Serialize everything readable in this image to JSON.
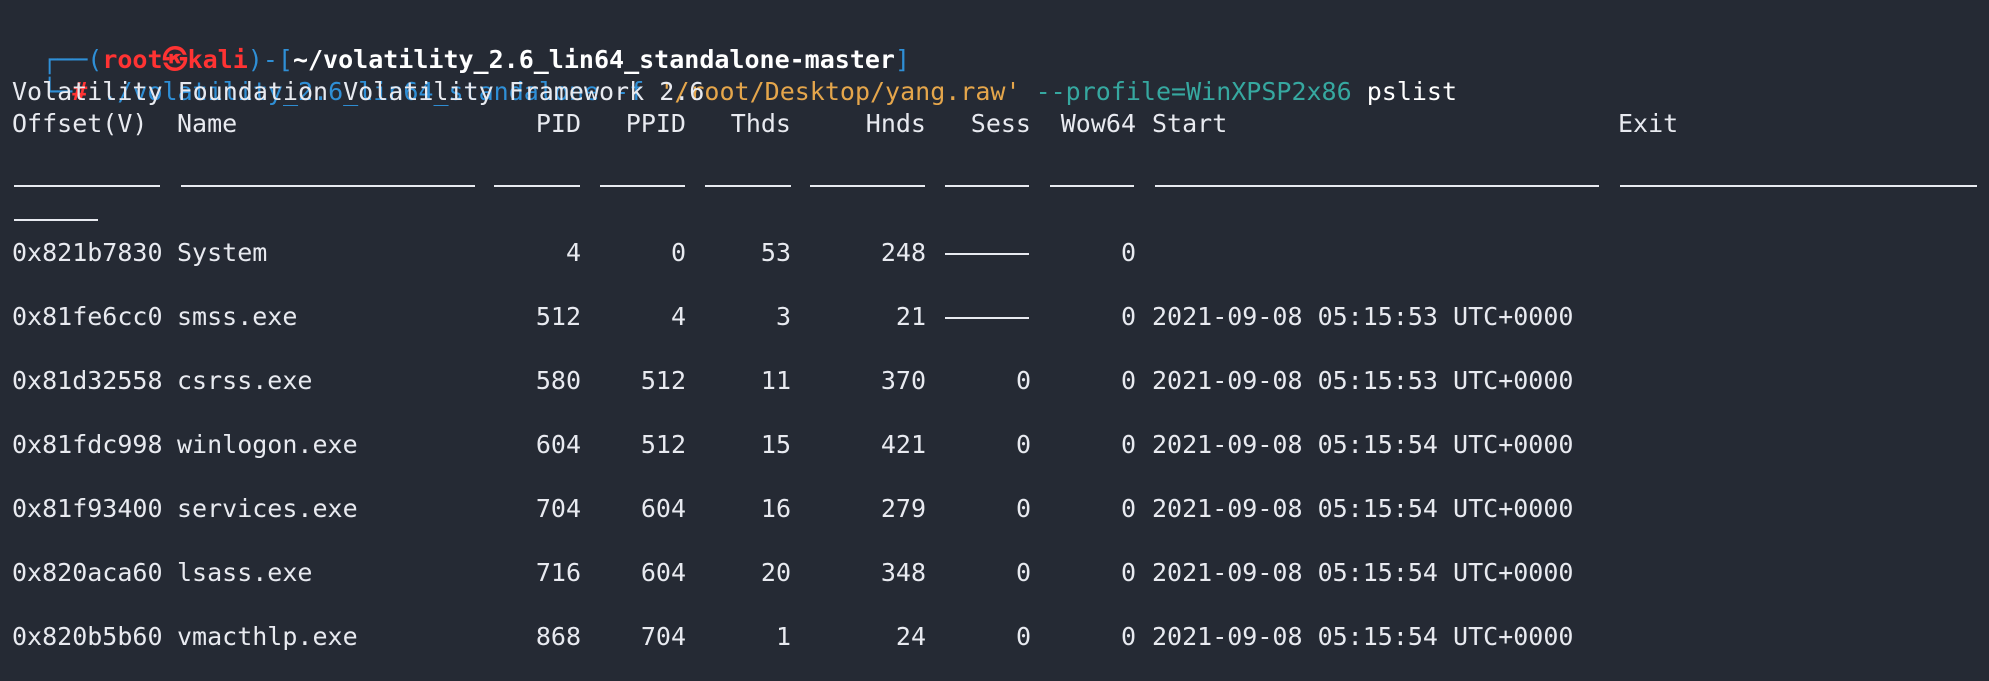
{
  "prompt": {
    "corner_top": "┌──(",
    "user": "root",
    "at_symbol": "㉿",
    "host": "kali",
    "bracket_mid": ")-[",
    "path": "~/volatility_2.6_lin64_standalone-master",
    "bracket_end": "]",
    "corner_bottom": "└─",
    "hash": "#"
  },
  "command": {
    "executable": "./volatility_2.6_lin64_standalone",
    "flag_f": "-f",
    "file_arg": "'/root/Desktop/yang.raw'",
    "profile": "--profile=WinXPSP2x86",
    "plugin": "pslist"
  },
  "banner": "Volatility Foundation Volatility Framework 2.6",
  "headers": [
    "Offset(V)",
    "Name",
    "PID",
    "PPID",
    "Thds",
    "Hnds",
    "Sess",
    "Wow64",
    "Start",
    "Exit"
  ],
  "rows": [
    {
      "offset": "0x821b7830",
      "name": "System",
      "pid": "4",
      "ppid": "0",
      "thds": "53",
      "hnds": "248",
      "sess": "------",
      "wow64": "0",
      "start": "",
      "exit": ""
    },
    {
      "offset": "0x81fe6cc0",
      "name": "smss.exe",
      "pid": "512",
      "ppid": "4",
      "thds": "3",
      "hnds": "21",
      "sess": "------",
      "wow64": "0",
      "start": "2021-09-08 05:15:53 UTC+0000",
      "exit": ""
    },
    {
      "offset": "0x81d32558",
      "name": "csrss.exe",
      "pid": "580",
      "ppid": "512",
      "thds": "11",
      "hnds": "370",
      "sess": "0",
      "wow64": "0",
      "start": "2021-09-08 05:15:53 UTC+0000",
      "exit": ""
    },
    {
      "offset": "0x81fdc998",
      "name": "winlogon.exe",
      "pid": "604",
      "ppid": "512",
      "thds": "15",
      "hnds": "421",
      "sess": "0",
      "wow64": "0",
      "start": "2021-09-08 05:15:54 UTC+0000",
      "exit": ""
    },
    {
      "offset": "0x81f93400",
      "name": "services.exe",
      "pid": "704",
      "ppid": "604",
      "thds": "16",
      "hnds": "279",
      "sess": "0",
      "wow64": "0",
      "start": "2021-09-08 05:15:54 UTC+0000",
      "exit": ""
    },
    {
      "offset": "0x820aca60",
      "name": "lsass.exe",
      "pid": "716",
      "ppid": "604",
      "thds": "20",
      "hnds": "348",
      "sess": "0",
      "wow64": "0",
      "start": "2021-09-08 05:15:54 UTC+0000",
      "exit": ""
    },
    {
      "offset": "0x820b5b60",
      "name": "vmacthlp.exe",
      "pid": "868",
      "ppid": "704",
      "thds": "1",
      "hnds": "24",
      "sess": "0",
      "wow64": "0",
      "start": "2021-09-08 05:15:54 UTC+0000",
      "exit": ""
    }
  ]
}
